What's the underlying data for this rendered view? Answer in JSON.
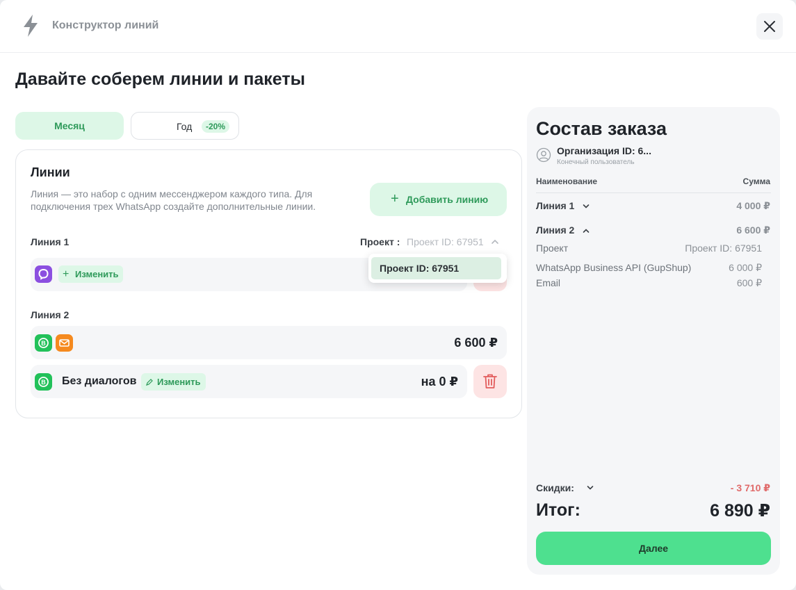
{
  "header": {
    "title": "Конструктор линий"
  },
  "page": {
    "title": "Давайте соберем линии и пакеты"
  },
  "period": {
    "month": "Месяц",
    "year": "Год",
    "year_discount": "-20%"
  },
  "lines_card": {
    "title": "Линии",
    "description": "Линия — это набор с одним мессенджером каждого типа. Для подключения трех WhatsApp создайте дополнительные линии.",
    "add_button": "Добавить линию",
    "add_icon": "+",
    "line1": {
      "label": "Линия 1",
      "project_label": "Проект :",
      "project_value": "Проект ID: 67951",
      "change": "Изменить",
      "change_icon": "+"
    },
    "line2": {
      "label": "Линия 2",
      "price": "6 600 ₽",
      "package": "Без диалогов",
      "change": "Изменить",
      "package_price": "на 0 ₽"
    },
    "dropdown": {
      "option": "Проект ID: 67951"
    }
  },
  "summary": {
    "title": "Состав заказа",
    "org_name": "Организация ID: 6...",
    "org_sub": "Конечный пользователь",
    "col_name": "Наименование",
    "col_sum": "Сумма",
    "line1": {
      "label": "Линия 1",
      "price": "4 000 ₽"
    },
    "line2": {
      "label": "Линия 2",
      "price": "6 600 ₽"
    },
    "details": [
      {
        "name": "Проект",
        "value": "Проект ID: 67951"
      },
      {
        "name": "WhatsApp Business API (GupShup)",
        "value": "6 000 ₽"
      },
      {
        "name": "Email",
        "value": "600 ₽"
      }
    ],
    "discount_label": "Скидки:",
    "discount_value": "- 3 710 ₽",
    "total_label": "Итог:",
    "total_value": "6 890 ₽",
    "next": "Далее"
  },
  "colors": {
    "accent": "#4ee08f",
    "accent_soft": "#ddf7e7",
    "danger_soft": "#fde4e4",
    "danger": "#e06a6a"
  }
}
